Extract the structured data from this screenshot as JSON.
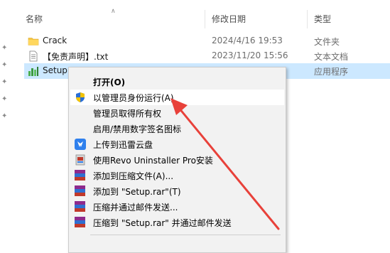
{
  "header": {
    "name": "名称",
    "date": "修改日期",
    "type": "类型"
  },
  "files": [
    {
      "name": "Crack",
      "date": "2024/4/16 19:53",
      "type": "文件夹",
      "icon": "folder-icon"
    },
    {
      "name": "【免责声明】.txt",
      "date": "2023/11/20 15:56",
      "type": "文本文档",
      "icon": "text-file-icon"
    },
    {
      "name": "Setup.",
      "date": "",
      "type": "应用程序",
      "icon": "setup-app-icon"
    }
  ],
  "context_menu": {
    "items": [
      {
        "label": "打开(O)",
        "icon": "",
        "bold": true
      },
      {
        "label": "以管理员身份运行(A)",
        "icon": "uac-shield-icon"
      },
      {
        "label": "管理员取得所有权",
        "icon": ""
      },
      {
        "label": "启用/禁用数字签名图标",
        "icon": ""
      },
      {
        "label": "上传到迅雷云盘",
        "icon": "xunlei-cloud-icon"
      },
      {
        "label": "使用Revo Uninstaller Pro安装",
        "icon": "revo-uninstaller-icon"
      },
      {
        "label": "添加到压缩文件(A)...",
        "icon": "winrar-icon"
      },
      {
        "label": "添加到 \"Setup.rar\"(T)",
        "icon": "winrar-icon"
      },
      {
        "label": "压缩并通过邮件发送...",
        "icon": "winrar-icon"
      },
      {
        "label": "压缩到 \"Setup.rar\" 并通过邮件发送",
        "icon": "winrar-icon"
      }
    ]
  },
  "colors": {
    "selection": "#cce8ff",
    "annotation_arrow": "#e8413a",
    "folder": "#f5c543"
  }
}
